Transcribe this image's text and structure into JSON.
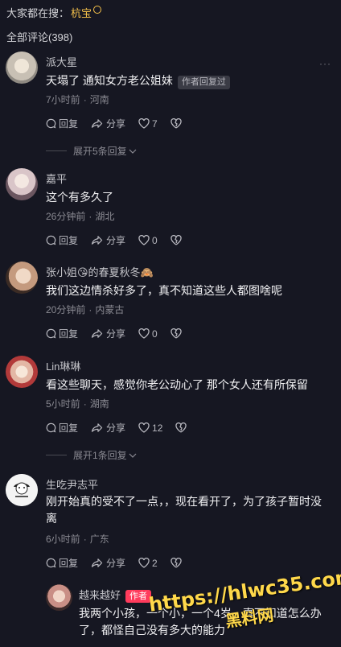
{
  "search_bar": {
    "prefix": "大家都在搜：",
    "keyword": "杭宝"
  },
  "comments_count_label": "全部评论(398)",
  "comments": [
    {
      "name": "派大星",
      "text": "天塌了  通知女方老公姐妹",
      "tag": "作者回复过",
      "time": "7小时前",
      "location": "河南",
      "reply": "回复",
      "share": "分享",
      "likes": "7",
      "expand": "展开5条回复"
    },
    {
      "name": "嘉平",
      "text": "这个有多久了",
      "time": "26分钟前",
      "location": "湖北",
      "reply": "回复",
      "share": "分享",
      "likes": "0"
    },
    {
      "name": "张小姐😘的春夏秋冬🙈",
      "text": "我们这边情杀好多了，真不知道这些人都图啥呢",
      "time": "20分钟前",
      "location": "内蒙古",
      "reply": "回复",
      "share": "分享",
      "likes": "0"
    },
    {
      "name": "Lin琳琳",
      "text": "看这些聊天，感觉你老公动心了 那个女人还有所保留",
      "time": "5小时前",
      "location": "湖南",
      "reply": "回复",
      "share": "分享",
      "likes": "12",
      "expand": "展开1条回复"
    },
    {
      "name": "生吃尹志平",
      "text": "刚开始真的受不了一点，，现在看开了，为了孩子暂时没离",
      "time": "6小时前",
      "location": "广东",
      "reply": "回复",
      "share": "分享",
      "likes": "2"
    }
  ],
  "reply_item": {
    "name": "越来越好",
    "badge": "作者",
    "text": "我两个小孩，一个小，一个4岁，真不知道怎么办了，都怪自己没有多大的能力"
  },
  "watermark": {
    "url": "https://hlwc35.com",
    "label": "黑料网"
  },
  "more_label": "···"
}
